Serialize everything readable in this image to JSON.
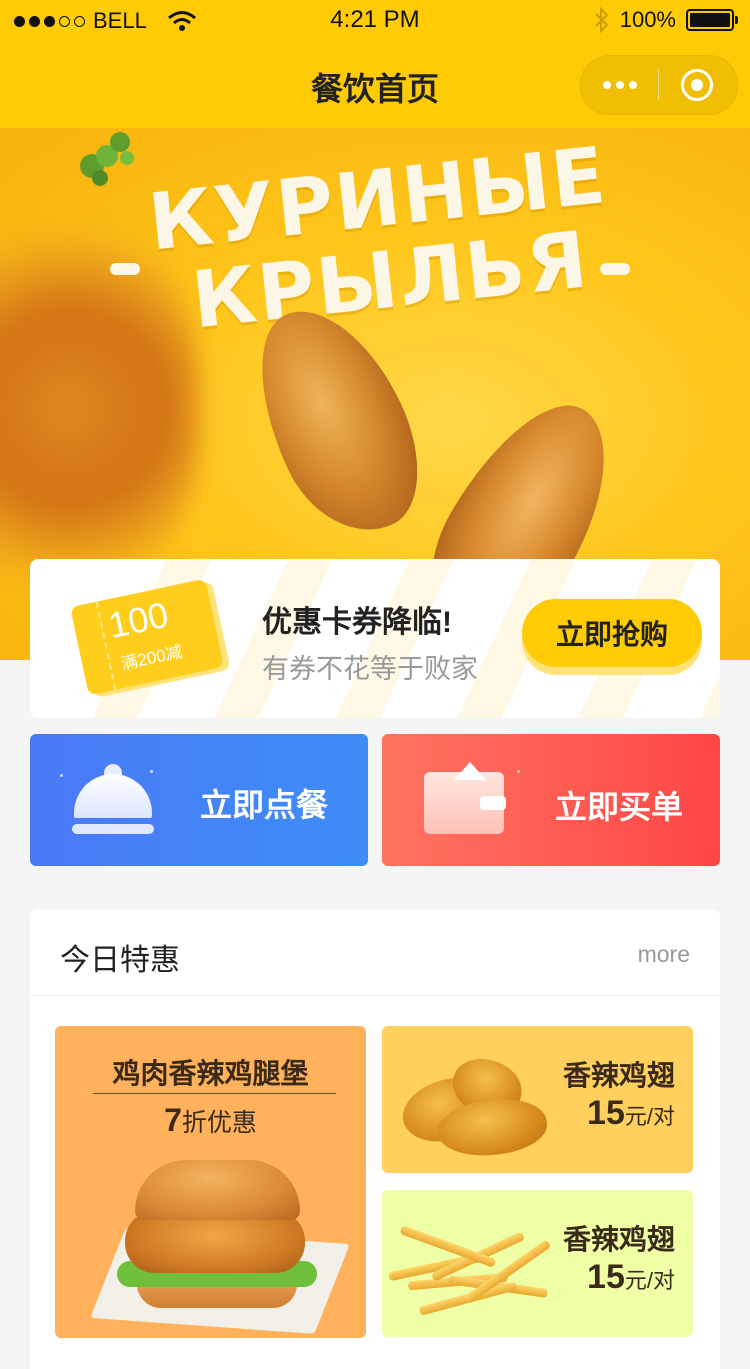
{
  "status_bar": {
    "carrier": "BELL",
    "time": "4:21 PM",
    "battery": "100%",
    "signal_icon": "signal-dots-icon",
    "wifi_icon": "wifi-icon",
    "bluetooth_icon": "bluetooth-icon",
    "battery_icon": "battery-icon"
  },
  "nav": {
    "title": "餐饮首页",
    "more_icon": "more-dots-icon",
    "close_icon": "target-close-icon"
  },
  "banner": {
    "headline_line1": "КУРИНЫЕ",
    "headline_line2": "КРЫЛЬЯ"
  },
  "coupon": {
    "ticket_value": "100",
    "ticket_condition": "满200减",
    "title": "优惠卡券降临!",
    "subtitle": "有券不花等于败家",
    "button_label": "立即抢购"
  },
  "actions": {
    "order_label": "立即点餐",
    "pay_label": "立即买单",
    "order_icon": "cloche-icon",
    "pay_icon": "wallet-icon"
  },
  "specials": {
    "title": "今日特惠",
    "more": "more",
    "featured": {
      "name": "鸡肉香辣鸡腿堡",
      "discount_num": "7",
      "discount_text": "折优惠"
    },
    "items": [
      {
        "name": "香辣鸡翅",
        "price": "15",
        "unit": "元/对"
      },
      {
        "name": "香辣鸡翅",
        "price": "15",
        "unit": "元/对"
      }
    ]
  },
  "colors": {
    "brand_yellow": "#ffcb05",
    "order_blue": "#4b79f6",
    "pay_red": "#ff4646"
  }
}
